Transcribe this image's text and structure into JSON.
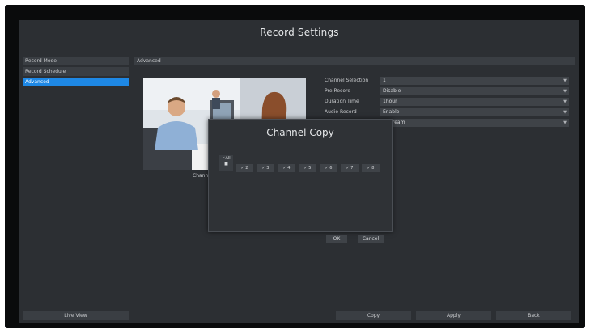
{
  "window": {
    "title": "Record Settings"
  },
  "sidebar": {
    "items": [
      {
        "label": "Record Mode",
        "active": false
      },
      {
        "label": "Record Schedule",
        "active": false
      },
      {
        "label": "Advanced",
        "active": true
      }
    ]
  },
  "section": {
    "label": "Advanced"
  },
  "preview": {
    "label": "Chann"
  },
  "settings": [
    {
      "label": "Channel Selection",
      "value": "1"
    },
    {
      "label": "Pre Record",
      "value": "Disable"
    },
    {
      "label": "Duration Time",
      "value": "1hour"
    },
    {
      "label": "Audio Record",
      "value": "Enable"
    },
    {
      "label": "",
      "value": "n Stream"
    }
  ],
  "dialog": {
    "title": "Channel Copy",
    "all_label": "All",
    "channels": [
      "2",
      "3",
      "4",
      "5",
      "6",
      "7",
      "8"
    ],
    "ok_label": "OK",
    "cancel_label": "Cancel"
  },
  "bottom": {
    "live_view": "Live View",
    "copy": "Copy",
    "apply": "Apply",
    "back": "Back"
  },
  "colors": {
    "accent": "#1e88e5",
    "panel": "#2c2f33",
    "field": "#3f4348"
  }
}
